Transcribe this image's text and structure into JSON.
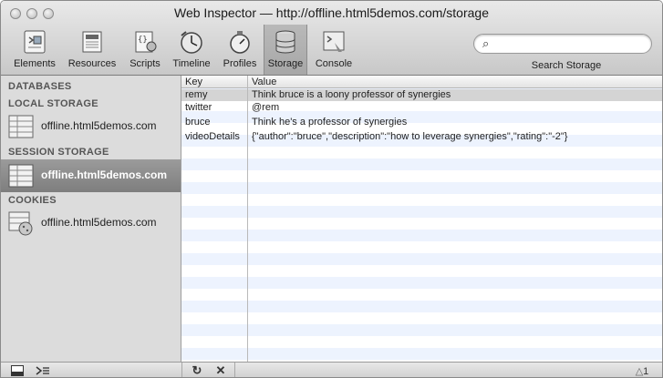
{
  "window": {
    "title": "Web Inspector — http://offline.html5demos.com/storage"
  },
  "toolbar": {
    "items": [
      {
        "label": "Elements",
        "icon": "elements-icon"
      },
      {
        "label": "Resources",
        "icon": "resources-icon"
      },
      {
        "label": "Scripts",
        "icon": "scripts-icon"
      },
      {
        "label": "Timeline",
        "icon": "timeline-icon"
      },
      {
        "label": "Profiles",
        "icon": "profiles-icon"
      },
      {
        "label": "Storage",
        "icon": "storage-icon"
      },
      {
        "label": "Console",
        "icon": "console-icon"
      }
    ],
    "active": "Storage",
    "search": {
      "label": "Search Storage",
      "placeholder": "",
      "icon": "search-icon"
    }
  },
  "sidebar": {
    "databases": "DATABASES",
    "local_storage": "LOCAL STORAGE",
    "local_item": "offline.html5demos.com",
    "session_storage": "SESSION STORAGE",
    "session_item": "offline.html5demos.com",
    "cookies": "COOKIES",
    "cookies_item": "offline.html5demos.com"
  },
  "grid": {
    "columns": [
      "Key",
      "Value"
    ],
    "rows": [
      {
        "key": "remy",
        "value": "Think bruce is a loony professor of synergies"
      },
      {
        "key": "twitter",
        "value": "@rem"
      },
      {
        "key": "bruce",
        "value": "Think he's a professor of synergies"
      },
      {
        "key": "videoDetails",
        "value": "{\"author\":\"bruce\",\"description\":\"how to leverage synergies\",\"rating\":\"-2\"}"
      }
    ],
    "selected_row": "remy"
  },
  "status": {
    "dock_icon": "dock-icon",
    "console_icon": "console-prompt-icon",
    "refresh_label": "↻",
    "delete_label": "✕",
    "warning_count": "1",
    "warning_icon": "warning-icon"
  },
  "colors": {
    "selected_sidebar": "#8a8a8a",
    "stripe": "#edf3fe"
  }
}
